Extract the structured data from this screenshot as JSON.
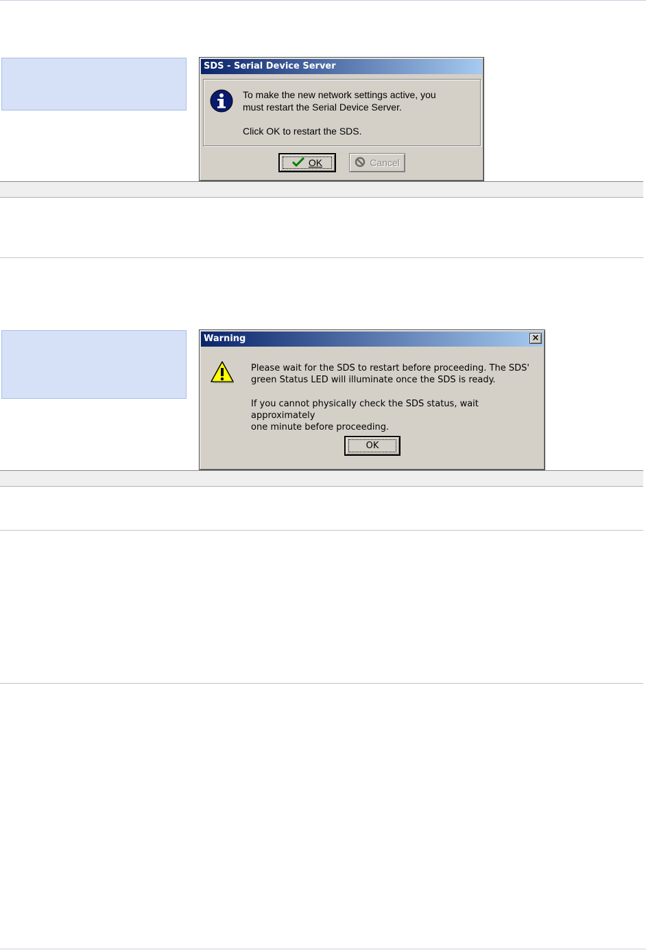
{
  "dialog1": {
    "title": "SDS - Serial Device Server",
    "icon": "info-icon",
    "message_line1": "To make the new network settings active, you",
    "message_line2": "must restart the Serial Device Server.",
    "message_line3": "Click OK to restart the SDS.",
    "ok_label": "OK",
    "cancel_label": "Cancel"
  },
  "dialog2": {
    "title": "Warning",
    "icon": "warning-icon",
    "close_label": "×",
    "message_line1": "Please wait for the SDS to restart before proceeding.  The SDS'",
    "message_line2": "green Status LED will illuminate once the SDS is ready.",
    "message_line3": "If you cannot physically check the SDS status, wait approximately",
    "message_line4": "one minute before proceeding.",
    "ok_label": "OK"
  },
  "colors": {
    "note_box": "#d6e1f8",
    "titlebar_start": "#0a246a",
    "titlebar_end": "#a6caf0",
    "dialog_face": "#d4d0c8"
  }
}
